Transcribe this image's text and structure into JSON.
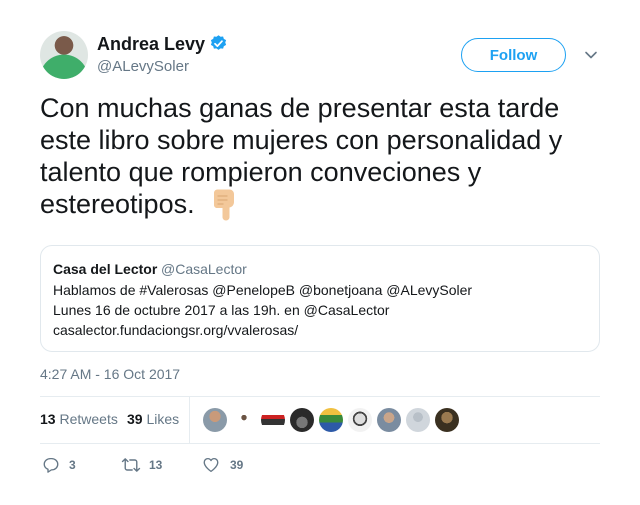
{
  "author": {
    "name": "Andrea Levy",
    "handle": "@ALevySoler"
  },
  "follow_label": "Follow",
  "tweet_text": "Con muchas ganas de presentar esta tarde este libro sobre mujeres con personalidad y talento que rompieron conveciones y estereotipos.",
  "emoji": "backhand-index-pointing-down",
  "quoted": {
    "name": "Casa del Lector",
    "handle": "@CasaLector",
    "lines": [
      "Hablamos de #Valerosas @PenelopeB @bonetjoana @ALevySoler",
      "Lunes 16 de octubre 2017 a las 19h. en @CasaLector",
      "casalector.fundaciongsr.org/vvalerosas/"
    ]
  },
  "timestamp": "4:27 AM - 16 Oct 2017",
  "stats": {
    "retweets_count": "13",
    "retweets_label": "Retweets",
    "likes_count": "39",
    "likes_label": "Likes"
  },
  "likers_avatars": 9,
  "actions": {
    "replies": "3",
    "retweets": "13",
    "likes": "39"
  },
  "colors": {
    "accent": "#1da1f2",
    "muted": "#657786",
    "border": "#e1e8ed"
  }
}
